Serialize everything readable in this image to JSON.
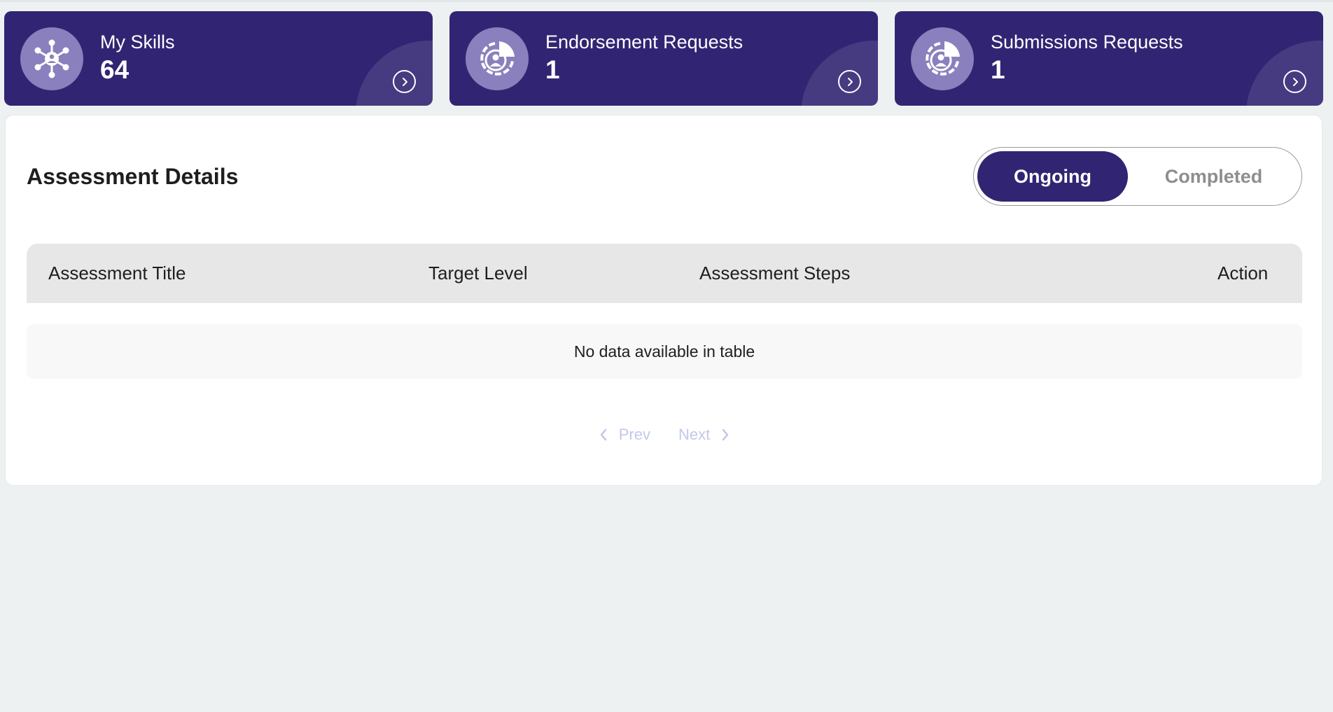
{
  "colors": {
    "brand": "#312573",
    "icon_circle": "#8a80bd",
    "page_bg": "#eef1f2",
    "pager_disabled": "#c3c8ea"
  },
  "cards": [
    {
      "title": "My Skills",
      "count": "64",
      "icon": "network-hub-icon",
      "action_icon": "chevron-right-circle-icon"
    },
    {
      "title": "Endorsement Requests",
      "count": "1",
      "icon": "user-target-pie-icon",
      "action_icon": "chevron-right-circle-icon"
    },
    {
      "title": "Submissions Requests",
      "count": "1",
      "icon": "user-target-pie-icon",
      "action_icon": "chevron-right-circle-icon"
    }
  ],
  "assessment": {
    "title": "Assessment Details",
    "tabs": [
      {
        "label": "Ongoing",
        "active": true
      },
      {
        "label": "Completed",
        "active": false
      }
    ],
    "columns": [
      "Assessment Title",
      "Target Level",
      "Assessment Steps",
      "Action"
    ],
    "empty_message": "No data available in table",
    "pagination": {
      "prev_label": "Prev",
      "next_label": "Next"
    }
  }
}
